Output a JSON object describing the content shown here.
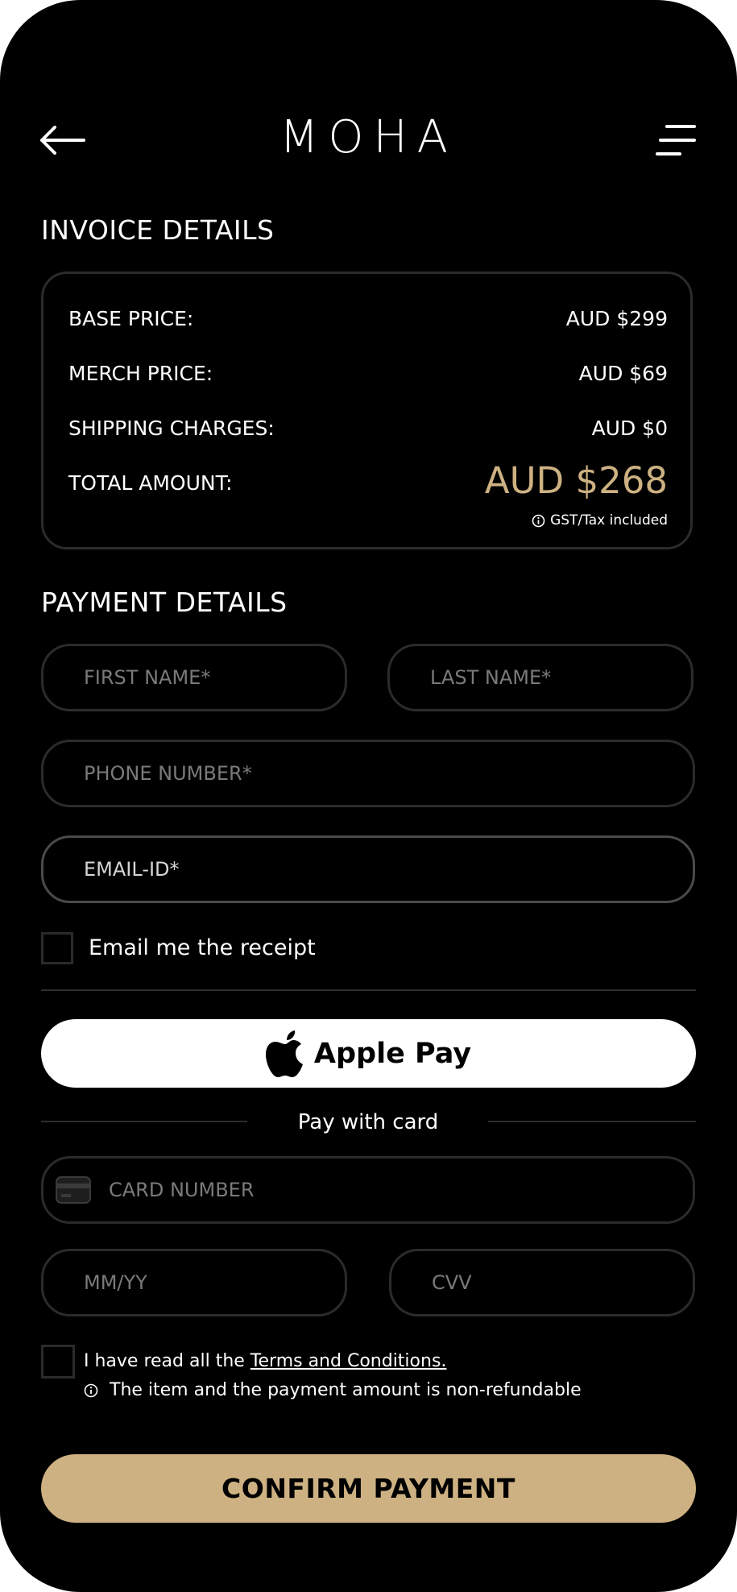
{
  "header": {
    "logo": "MOHA"
  },
  "invoice": {
    "title": "INVOICE DETAILS",
    "rows": [
      {
        "label": "BASE PRICE:",
        "value": "AUD $299"
      },
      {
        "label": "MERCH PRICE:",
        "value": "AUD $69"
      },
      {
        "label": "SHIPPING CHARGES:",
        "value": "AUD $0"
      }
    ],
    "total_label": "TOTAL AMOUNT:",
    "total_value": "AUD $268",
    "tax_note": "GST/Tax included"
  },
  "payment": {
    "title": "PAYMENT DETAILS",
    "first_name_placeholder": "FIRST NAME*",
    "last_name_placeholder": "LAST NAME*",
    "phone_placeholder": "PHONE NUMBER*",
    "email_placeholder": "EMAIL-ID*",
    "email_receipt_label": "Email me the receipt",
    "apple_pay_label": "Apple Pay",
    "pay_with_card_label": "Pay with card",
    "card_number_placeholder": "CARD NUMBER",
    "expiry_placeholder": "MM/YY",
    "cvv_placeholder": "CVV",
    "terms_prefix": "I have read all the ",
    "terms_link": "Terms and Conditions.",
    "refund_note": "The item and the payment amount is non-refundable",
    "confirm_label": "CONFIRM PAYMENT"
  },
  "colors": {
    "background": "#000000",
    "accent": "#cdb182",
    "border": "#2b2b2b"
  }
}
